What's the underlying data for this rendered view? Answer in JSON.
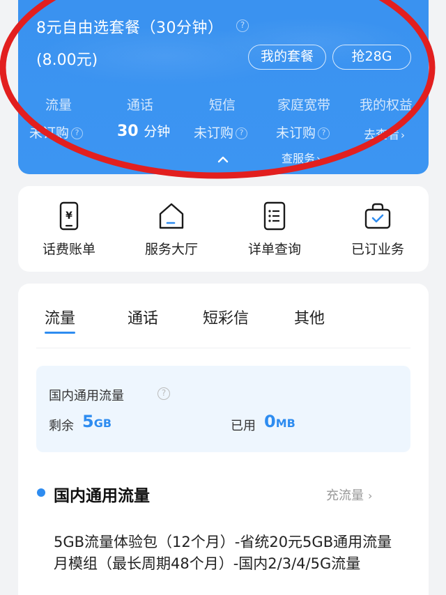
{
  "plan": {
    "title": "8元自由选套餐（30分钟）",
    "price": "(8.00元)",
    "my_plan_button": "我的套餐",
    "grab_button": "抢28G",
    "stats": [
      {
        "label": "流量",
        "value": "未订购"
      },
      {
        "label": "通话",
        "value": "30",
        "unit": "分钟"
      },
      {
        "label": "短信",
        "value": "未订购"
      },
      {
        "label": "家庭宽带",
        "value": "未订购"
      },
      {
        "label": "我的权益",
        "value": "去查看"
      }
    ],
    "check_service": "查服务"
  },
  "quick_actions": [
    {
      "label": "话费账单",
      "icon": "bill-phone-icon"
    },
    {
      "label": "服务大厅",
      "icon": "home-icon"
    },
    {
      "label": "详单查询",
      "icon": "detail-list-icon"
    },
    {
      "label": "已订业务",
      "icon": "bag-check-icon"
    }
  ],
  "tabs": [
    "流量",
    "通话",
    "短彩信",
    "其他"
  ],
  "active_tab": "流量",
  "data_usage": {
    "title": "国内通用流量",
    "remain_label": "剩余",
    "remain_value": "5",
    "remain_unit": "GB",
    "used_label": "已用",
    "used_value": "0",
    "used_unit": "MB"
  },
  "section": {
    "title": "国内通用流量",
    "recharge": "充流量",
    "package_desc": "5GB流量体验包（12个月）-省统20元5GB通用流量月模组（最长周期48个月）-国内2/3/4/5G流量"
  },
  "colors": {
    "brand_blue": "#3a92f0",
    "accent_blue": "#2e8cf0",
    "annotation_red": "#e21f1f"
  }
}
